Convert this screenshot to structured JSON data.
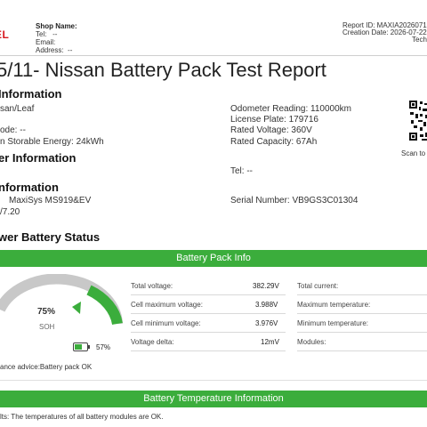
{
  "header": {
    "logo": "EL",
    "shop_name_label": "Shop Name:",
    "tel_label": "Tel:",
    "tel_value": "--",
    "email_label": "Email:",
    "address_label": "Address:",
    "address_value": "--",
    "report_id": "Report ID:  MAXIA2026071",
    "creation_date": "Creation Date:   2026-07-22",
    "technician": "Techni"
  },
  "title": "5/11- Nissan Battery Pack Test Report",
  "vehicle": {
    "heading": "Information",
    "model": "san/Leaf",
    "odometer": "Odometer Reading: 110000km",
    "plate": "License Plate: 179716",
    "mode": "ode: --",
    "rated_voltage": "Rated Voltage: 360V",
    "storable": "n Storable Energy: 24kWh",
    "rated_capacity": "Rated Capacity: 67Ah"
  },
  "customer": {
    "heading": "er Information",
    "tel": "Tel: --"
  },
  "device": {
    "heading": "nformation",
    "name": "MaxiSys MS919&EV",
    "serial": "Serial Number: VB9GS3C01304",
    "version": "/7.20"
  },
  "scan_label": "Scan to",
  "battery_status": {
    "heading": "wer Battery Status",
    "bar_title": "Battery Pack Info",
    "soh_value": "75%",
    "soh_label": "SOH",
    "soh_fraction": 0.75,
    "battery_pct": "57%",
    "advice": "ance advice:Battery pack OK"
  },
  "pack_info": {
    "rows": [
      {
        "label": "Total voltage:",
        "value": "382.29V"
      },
      {
        "label": "Cell maximum voltage:",
        "value": "3.988V"
      },
      {
        "label": "Cell minimum voltage:",
        "value": "3.976V"
      },
      {
        "label": "Voltage delta:",
        "value": "12mV"
      }
    ],
    "right_rows": [
      {
        "label": "Total current:"
      },
      {
        "label": "Maximum temperature:"
      },
      {
        "label": "Minimum temperature:"
      },
      {
        "label": "Modules:"
      }
    ]
  },
  "temperature": {
    "bar_title": "Battery Temperature Information",
    "results": "lts: The temperatures of all battery modules are OK."
  },
  "colors": {
    "green": "#3bad3c",
    "brand_red": "#d6181f",
    "gauge_gray": "#c8c8c8"
  }
}
